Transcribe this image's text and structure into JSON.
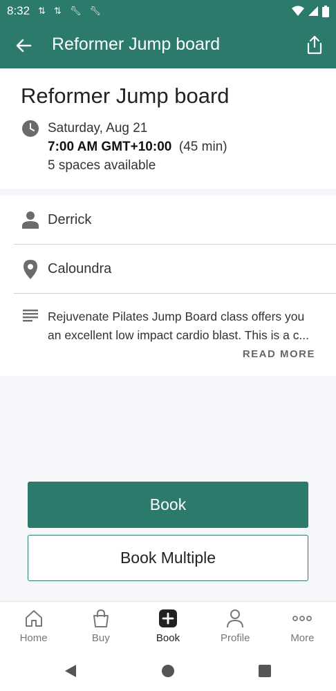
{
  "status_bar": {
    "time": "8:32",
    "notification_icons": [
      "signal-arrows-icon",
      "signal-arrows-icon",
      "wrench-icon",
      "wrench-icon"
    ],
    "right_icons": [
      "wifi-icon",
      "cell-signal-icon",
      "battery-icon"
    ]
  },
  "app_bar": {
    "title": "Reformer Jump board",
    "back_icon": "back-arrow-icon",
    "share_icon": "share-icon",
    "color": "#2b7a6b"
  },
  "class_info": {
    "title": "Reformer Jump board",
    "date": "Saturday, Aug 21",
    "time": "7:00 AM GMT+10:00",
    "duration": "(45 min)",
    "spaces": "5 spaces available"
  },
  "details": {
    "instructor": "Derrick",
    "location": "Caloundra",
    "description_line1": "Rejuvenate Pilates Jump Board class offers you",
    "description_line2": "an excellent low impact cardio blast. This is a c...",
    "read_more": "READ MORE"
  },
  "actions": {
    "book": "Book",
    "book_multiple": "Book Multiple"
  },
  "bottom_nav": {
    "items": [
      {
        "label": "Home",
        "icon": "home-icon"
      },
      {
        "label": "Buy",
        "icon": "shopping-bag-icon"
      },
      {
        "label": "Book",
        "icon": "plus-square-icon",
        "active": true
      },
      {
        "label": "Profile",
        "icon": "person-icon"
      },
      {
        "label": "More",
        "icon": "more-dots-icon"
      }
    ]
  },
  "system_nav": {
    "icons": [
      "back-triangle-icon",
      "home-circle-icon",
      "recents-square-icon"
    ]
  }
}
